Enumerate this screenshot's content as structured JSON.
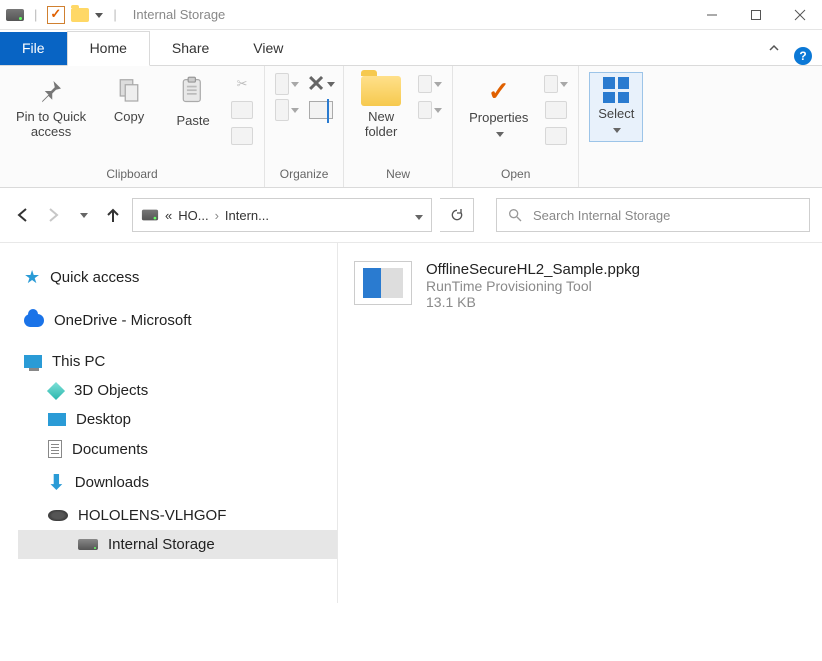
{
  "window": {
    "title": "Internal Storage"
  },
  "ribbon": {
    "tabs": {
      "file": "File",
      "home": "Home",
      "share": "Share",
      "view": "View"
    },
    "groups": {
      "clipboard": {
        "label": "Clipboard",
        "pin": "Pin to Quick\naccess",
        "copy": "Copy",
        "paste": "Paste"
      },
      "organize": {
        "label": "Organize"
      },
      "new": {
        "label": "New",
        "newfolder": "New\nfolder"
      },
      "open": {
        "label": "Open",
        "properties": "Properties"
      },
      "select": {
        "label": "Select"
      }
    }
  },
  "address": {
    "crumb1": "HO...",
    "crumb2": "Intern...",
    "prefix": "«"
  },
  "search": {
    "placeholder": "Search Internal Storage"
  },
  "nav": {
    "quick_access": "Quick access",
    "onedrive": "OneDrive - Microsoft",
    "this_pc": "This PC",
    "three_d": "3D Objects",
    "desktop": "Desktop",
    "documents": "Documents",
    "downloads": "Downloads",
    "hololens": "HOLOLENS-VLHGOF",
    "internal": "Internal Storage"
  },
  "files": [
    {
      "name": "OfflineSecureHL2_Sample.ppkg",
      "type": "RunTime Provisioning Tool",
      "size": "13.1 KB"
    }
  ]
}
